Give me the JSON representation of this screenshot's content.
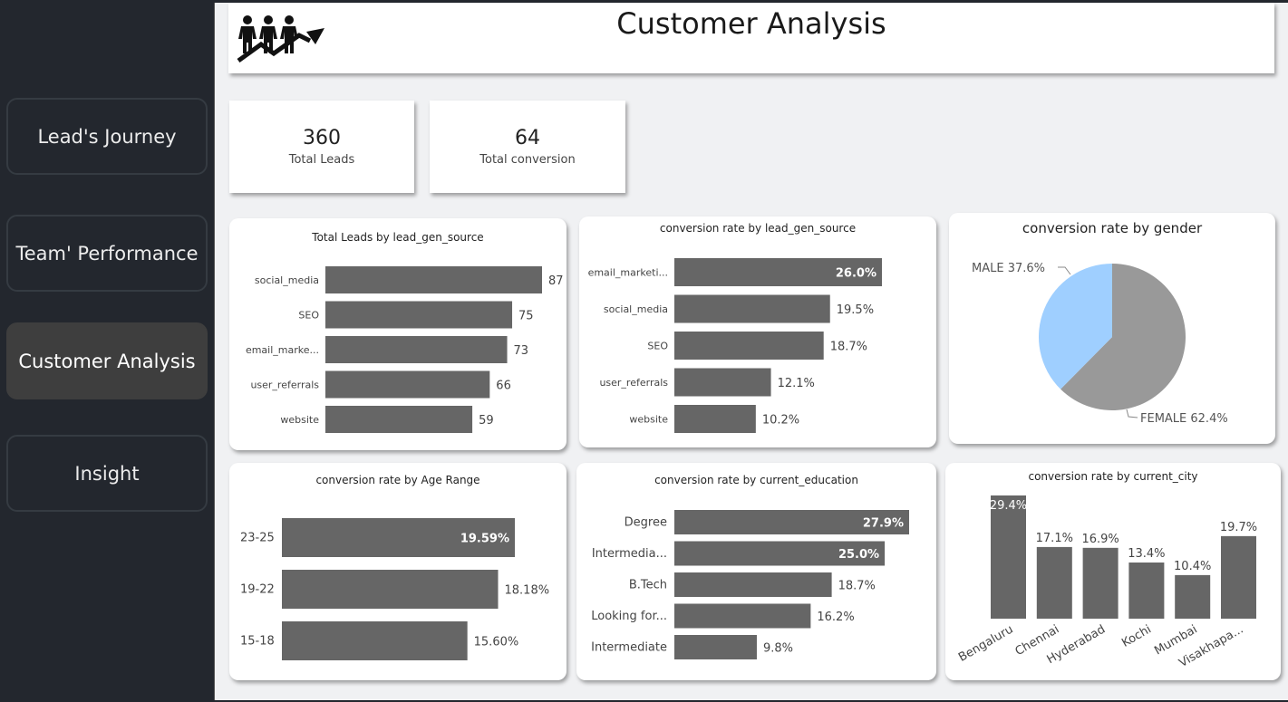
{
  "nav": {
    "items": [
      {
        "label": "Lead's Journey",
        "active": false
      },
      {
        "label": "Team' Performance",
        "active": false
      },
      {
        "label": "Customer Analysis",
        "active": true
      },
      {
        "label": "Insight",
        "active": false
      }
    ]
  },
  "header": {
    "title": "Customer Analysis",
    "logo_icon": "people-growth-arrow-icon"
  },
  "kpis": [
    {
      "value": "360",
      "label": "Total Leads"
    },
    {
      "value": "64",
      "label": "Total conversion"
    }
  ],
  "colors": {
    "bar": "#666666",
    "pie_male": "#9fcfff",
    "pie_female": "#999999",
    "accent_active": "#3e3e3e"
  },
  "chart_data": [
    {
      "id": "leads_by_source",
      "type": "bar",
      "orientation": "horizontal",
      "title": "Total Leads by lead_gen_source",
      "categories": [
        "social_media",
        "SEO",
        "email_marke...",
        "user_referrals",
        "website"
      ],
      "values": [
        87,
        75,
        73,
        66,
        59
      ],
      "labels": [
        "87",
        "75",
        "73",
        "66",
        "59"
      ]
    },
    {
      "id": "conv_by_source",
      "type": "bar",
      "orientation": "horizontal",
      "title": "conversion rate by lead_gen_source",
      "categories": [
        "email_marketi...",
        "social_media",
        "SEO",
        "user_referrals",
        "website"
      ],
      "values": [
        26.0,
        19.5,
        18.7,
        12.1,
        10.2
      ],
      "labels": [
        "26.0%",
        "19.5%",
        "18.7%",
        "12.1%",
        "10.2%"
      ]
    },
    {
      "id": "conv_by_gender",
      "type": "pie",
      "title": "conversion rate by gender",
      "slices": [
        {
          "name": "MALE",
          "value": 37.6,
          "label": "MALE 37.6%"
        },
        {
          "name": "FEMALE",
          "value": 62.4,
          "label": "FEMALE 62.4%"
        }
      ]
    },
    {
      "id": "conv_by_age",
      "type": "bar",
      "orientation": "horizontal",
      "title": "conversion rate by Age Range",
      "categories": [
        "23-25",
        "19-22",
        "15-18"
      ],
      "values": [
        19.59,
        18.18,
        15.6
      ],
      "labels": [
        "19.59%",
        "18.18%",
        "15.60%"
      ]
    },
    {
      "id": "conv_by_education",
      "type": "bar",
      "orientation": "horizontal",
      "title": "conversion rate by current_education",
      "categories": [
        "Degree",
        "Intermedia...",
        "B.Tech",
        "Looking for...",
        "Intermediate"
      ],
      "values": [
        27.9,
        25.0,
        18.7,
        16.2,
        9.8
      ],
      "labels": [
        "27.9%",
        "25.0%",
        "18.7%",
        "16.2%",
        "9.8%"
      ]
    },
    {
      "id": "conv_by_city",
      "type": "bar",
      "orientation": "vertical",
      "title": "conversion rate by current_city",
      "categories": [
        "Bengaluru",
        "Chennai",
        "Hyderabad",
        "Kochi",
        "Mumbai",
        "Visakhapa..."
      ],
      "values": [
        29.4,
        17.1,
        16.9,
        13.4,
        10.4,
        19.7
      ],
      "labels": [
        "29.4%",
        "17.1%",
        "16.9%",
        "13.4%",
        "10.4%",
        "19.7%"
      ]
    }
  ]
}
